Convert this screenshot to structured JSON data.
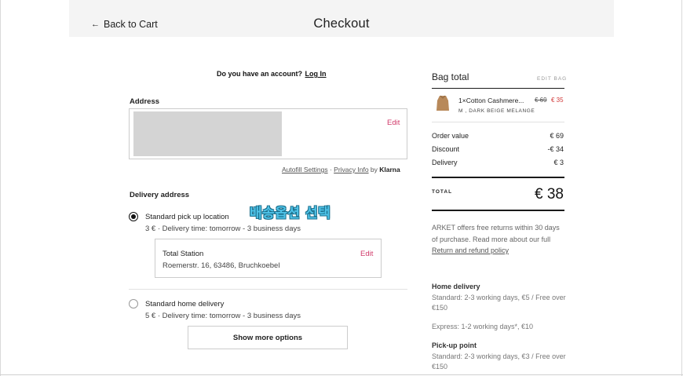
{
  "header": {
    "back_label": "Back to Cart",
    "title": "Checkout"
  },
  "account": {
    "prompt": "Do you have an account?",
    "login_label": "Log In"
  },
  "address": {
    "section_title": "Address",
    "edit_label": "Edit",
    "autofill": {
      "settings_label": "Autofill Settings",
      "separator": " · ",
      "privacy_label": "Privacy Info",
      "by_label": " by ",
      "brand": "Klarna"
    }
  },
  "delivery": {
    "section_title": "Delivery address",
    "options": [
      {
        "title": "Standard pick up location",
        "subtitle": "3 € · Delivery time: tomorrow - 3 business days",
        "selected": true
      },
      {
        "title": "Standard home delivery",
        "subtitle": "5 € · Delivery time: tomorrow - 3 business days",
        "selected": false
      }
    ],
    "station": {
      "name": "Total Station",
      "address": "Roemerstr. 16, 63486, Bruchkoebel",
      "edit_label": "Edit"
    },
    "more_options_label": "Show more options"
  },
  "caption_overlay": "배송옵션 선택",
  "bag": {
    "title": "Bag total",
    "edit_label": "EDIT BAG",
    "item": {
      "name": "1×Cotton Cashmere...",
      "price_old": "€ 69",
      "price_new": "€ 35",
      "variant": "M , DARK BEIGE MELANGE",
      "thumb_color": "#b8895a"
    },
    "summary": [
      {
        "label": "Order value",
        "value": "€ 69"
      },
      {
        "label": "Discount",
        "value": "-€ 34"
      },
      {
        "label": "Delivery",
        "value": "€ 3"
      }
    ],
    "total_label": "TOTAL",
    "total_value": "€ 38",
    "returns": {
      "text": "ARKET offers free returns within 30 days of purchase. Read more about our full ",
      "link_label": "Return and refund policy"
    }
  },
  "shipping_info": [
    {
      "heading": "Home delivery",
      "lines": [
        "Standard: 2-3 working days, €5 / Free over €150",
        "Express: 1-2 working days*, €10"
      ]
    },
    {
      "heading": "Pick-up point",
      "lines": [
        "Standard: 2-3 working days, €3 / Free over €150"
      ]
    }
  ],
  "colors": {
    "accent_edit": "#d13a6a",
    "sale_price": "#d13a3a",
    "caption": "#4fc3e8"
  }
}
